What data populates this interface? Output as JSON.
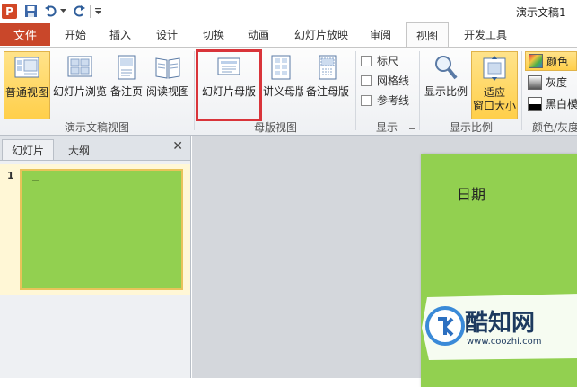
{
  "titlebar": {
    "app_icon_letter": "P",
    "doc_title": "演示文稿1 -"
  },
  "tabs": {
    "file": "文件",
    "items": [
      "开始",
      "插入",
      "设计",
      "切换",
      "动画",
      "幻灯片放映",
      "审阅",
      "视图",
      "开发工具"
    ],
    "active": "视图"
  },
  "ribbon": {
    "presentation_views": {
      "label": "演示文稿视图",
      "buttons": [
        "普通视图",
        "幻灯片浏览",
        "备注页",
        "阅读视图"
      ]
    },
    "master_views": {
      "label": "母版视图",
      "buttons": [
        "幻灯片母版",
        "讲义母版",
        "备注母版"
      ]
    },
    "show": {
      "label": "显示",
      "checkboxes": [
        "标尺",
        "网格线",
        "参考线"
      ]
    },
    "zoom": {
      "label": "显示比例",
      "buttons": [
        "显示比例",
        "适应\n窗口大小"
      ]
    },
    "color": {
      "label": "颜色/灰度",
      "buttons": [
        "颜色",
        "灰度",
        "黑白模"
      ]
    }
  },
  "left_pane": {
    "tabs": [
      "幻灯片",
      "大纲"
    ],
    "close": "✕",
    "slides": [
      {
        "number": "1"
      }
    ]
  },
  "slide": {
    "date_placeholder": "日期",
    "background": "#92d050"
  },
  "watermark": {
    "name": "酷知网",
    "url": "www.coozhi.com"
  },
  "colors": {
    "file_tab": "#c9472a",
    "selected": "#ffd966",
    "highlight_box": "#d9343a",
    "slide_green": "#92d050"
  }
}
